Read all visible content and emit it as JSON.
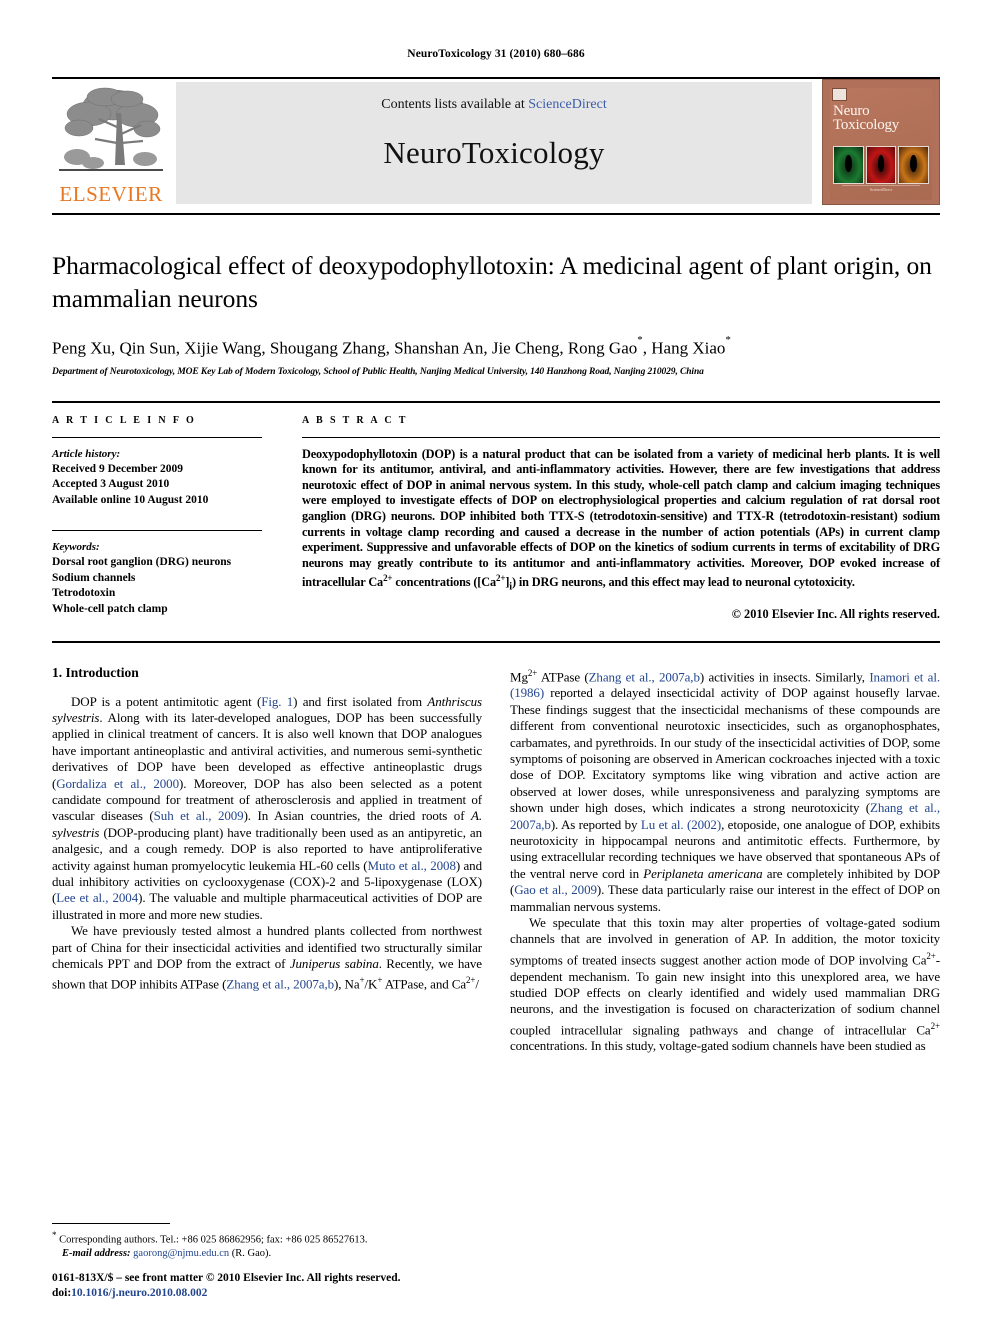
{
  "running_head": "NeuroToxicology 31 (2010) 680–686",
  "masthead": {
    "publisher_logo_text": "ELSEVIER",
    "contents_prefix": "Contents lists available at ",
    "contents_link": "ScienceDirect",
    "journal_name": "NeuroToxicology",
    "cover": {
      "title_line1": "Neuro",
      "title_line2": "Toxicology",
      "footer_text": "ScienceDirect"
    }
  },
  "title": "Pharmacological effect of deoxypodophyllotoxin: A medicinal agent of plant origin, on mammalian neurons",
  "authors": "Peng Xu, Qin Sun, Xijie Wang, Shougang Zhang, Shanshan An, Jie Cheng, Rong Gao",
  "authors_tail": ", Hang Xiao",
  "author_marker": "*",
  "affiliation": "Department of Neurotoxicology, MOE Key Lab of Modern Toxicology, School of Public Health, Nanjing Medical University, 140 Hanzhong Road, Nanjing 210029, China",
  "article_info": {
    "heading": "A R T I C L E    I N F O",
    "history_label": "Article history:",
    "history": [
      "Received 9 December 2009",
      "Accepted 3 August 2010",
      "Available online 10 August 2010"
    ],
    "keywords_label": "Keywords:",
    "keywords": [
      "Dorsal root ganglion (DRG) neurons",
      "Sodium channels",
      "Tetrodotoxin",
      "Whole-cell patch clamp"
    ]
  },
  "abstract": {
    "heading": "A B S T R A C T",
    "text": "Deoxypodophyllotoxin (DOP) is a natural product that can be isolated from a variety of medicinal herb plants. It is well known for its antitumor, antiviral, and anti-inflammatory activities. However, there are few investigations that address neurotoxic effect of DOP in animal nervous system. In this study, whole-cell patch clamp and calcium imaging techniques were employed to investigate effects of DOP on electrophysiological properties and calcium regulation of rat dorsal root ganglion (DRG) neurons. DOP inhibited both TTX-S (tetrodotoxin-sensitive) and TTX-R (tetrodotoxin-resistant) sodium currents in voltage clamp recording and caused a decrease in the number of action potentials (APs) in current clamp experiment. Suppressive and unfavorable effects of DOP on the kinetics of sodium currents in terms of excitability of DRG neurons may greatly contribute to its antitumor and anti-inflammatory activities. Moreover, DOP evoked increase of intracellular Ca",
    "text_sup1": "2+",
    "text_mid": " concentrations ([Ca",
    "text_sup2": "2+",
    "text_sub": "]",
    "text_subscript": "i",
    "text_end": ") in DRG neurons, and this effect may lead to neuronal cytotoxicity.",
    "copyright": "© 2010 Elsevier Inc. All rights reserved."
  },
  "body": {
    "section_number_title": "1. Introduction",
    "left_paragraphs": [
      {
        "id": "p1",
        "parts": [
          {
            "t": "DOP is a potent antimitotic agent ("
          },
          {
            "t": "Fig. 1",
            "style": "ref"
          },
          {
            "t": ") and first isolated from "
          },
          {
            "t": "Anthriscus sylvestris",
            "style": "ital"
          },
          {
            "t": ". Along with its later-developed analogues, DOP has been successfully applied in clinical treatment of cancers. It is also well known that DOP analogues have important antineoplastic and antiviral activities, and numerous semi-synthetic derivatives of DOP have been developed as effective antineoplastic drugs ("
          },
          {
            "t": "Gordaliza et al., 2000",
            "style": "ref"
          },
          {
            "t": "). Moreover, DOP has also been selected as a potent candidate compound for treatment of atherosclerosis and applied in treatment of vascular diseases ("
          },
          {
            "t": "Suh et al., 2009",
            "style": "ref"
          },
          {
            "t": "). In Asian countries, the dried roots of "
          },
          {
            "t": "A. sylvestris",
            "style": "ital"
          },
          {
            "t": " (DOP-producing plant) have traditionally been used as an antipyretic, an analgesic, and a cough remedy. DOP is also reported to have antiproliferative activity against human promyelocytic leukemia HL-60 cells ("
          },
          {
            "t": "Muto et al., 2008",
            "style": "ref"
          },
          {
            "t": ") and dual inhibitory activities on cyclooxygenase (COX)-2 and 5-lipoxygenase (LOX) ("
          },
          {
            "t": "Lee et al., 2004",
            "style": "ref"
          },
          {
            "t": "). The valuable and multiple pharmaceutical activities of DOP are illustrated in more and more new studies."
          }
        ]
      },
      {
        "id": "p2",
        "parts": [
          {
            "t": "We have previously tested almost a hundred plants collected from northwest part of China for their insecticidal activities and identified two structurally similar chemicals PPT and DOP from the extract of "
          },
          {
            "t": "Juniperus sabina",
            "style": "ital"
          },
          {
            "t": ". Recently, we have shown that DOP inhibits ATPase ("
          },
          {
            "t": "Zhang et al., 2007a,b",
            "style": "ref"
          },
          {
            "t": "), Na"
          },
          {
            "t": "+",
            "style": "sup"
          },
          {
            "t": "/K"
          },
          {
            "t": "+",
            "style": "sup"
          },
          {
            "t": " ATPase, and Ca"
          },
          {
            "t": "2+",
            "style": "sup"
          },
          {
            "t": "/"
          }
        ]
      }
    ],
    "right_paragraphs": [
      {
        "id": "p3",
        "indent": false,
        "parts": [
          {
            "t": "Mg"
          },
          {
            "t": "2+",
            "style": "sup"
          },
          {
            "t": " ATPase ("
          },
          {
            "t": "Zhang et al., 2007a,b",
            "style": "ref"
          },
          {
            "t": ") activities in insects. Similarly, "
          },
          {
            "t": "Inamori et al. (1986)",
            "style": "ref"
          },
          {
            "t": " reported a delayed insecticidal activity of DOP against housefly larvae. These findings suggest that the insecticidal mechanisms of these compounds are different from conventional neurotoxic insecticides, such as organophosphates, carbamates, and pyrethroids. In our study of the insecticidal activities of DOP, some symptoms of poisoning are observed in American cockroaches injected with a toxic dose of DOP. Excitatory symptoms like wing vibration and active action are observed at lower doses, while unresponsiveness and paralyzing symptoms are shown under high doses, which indicates a strong neurotoxicity ("
          },
          {
            "t": "Zhang et al., 2007a,b",
            "style": "ref"
          },
          {
            "t": "). As reported by "
          },
          {
            "t": "Lu et al. (2002)",
            "style": "ref"
          },
          {
            "t": ", etoposide, one analogue of DOP, exhibits neurotoxicity in hippocampal neurons and antimitotic effects. Furthermore, by using extracellular recording techniques we have observed that spontaneous APs of the ventral nerve cord in "
          },
          {
            "t": "Periplaneta americana",
            "style": "ital"
          },
          {
            "t": " are completely inhibited by DOP ("
          },
          {
            "t": "Gao et al., 2009",
            "style": "ref"
          },
          {
            "t": "). These data particularly raise our interest in the effect of DOP on mammalian nervous systems."
          }
        ]
      },
      {
        "id": "p4",
        "indent": true,
        "parts": [
          {
            "t": "We speculate that this toxin may alter properties of voltage-gated sodium channels that are involved in generation of AP. In addition, the motor toxicity symptoms of treated insects suggest another action mode of DOP involving Ca"
          },
          {
            "t": "2+",
            "style": "sup"
          },
          {
            "t": "-dependent mechanism. To gain new insight into this unexplored area, we have studied DOP effects on clearly identified and widely used mammalian DRG neurons, and the investigation is focused on characterization of sodium channel coupled intracellular signaling pathways and change of intracellular Ca"
          },
          {
            "t": "2+",
            "style": "sup"
          },
          {
            "t": " concentrations. In this study, voltage-gated sodium channels have been studied as"
          }
        ]
      }
    ]
  },
  "footnote": {
    "marker": "*",
    "corresponding": " Corresponding authors. Tel.: +86 025 86862956; fax: +86 025 86527613.",
    "email_label": "E-mail address:",
    "email": "gaorong@njmu.edu.cn",
    "email_suffix": " (R. Gao)."
  },
  "imprint": {
    "line1": "0161-813X/$ – see front matter © 2010 Elsevier Inc. All rights reserved.",
    "doi_label": "doi:",
    "doi": "10.1016/j.neuro.2010.08.002"
  },
  "colors": {
    "link": "#24478f",
    "sciencedirect": "#3c5ca8",
    "elsevier_orange": "#E87722",
    "banner_bg": "#e6e6e6"
  }
}
